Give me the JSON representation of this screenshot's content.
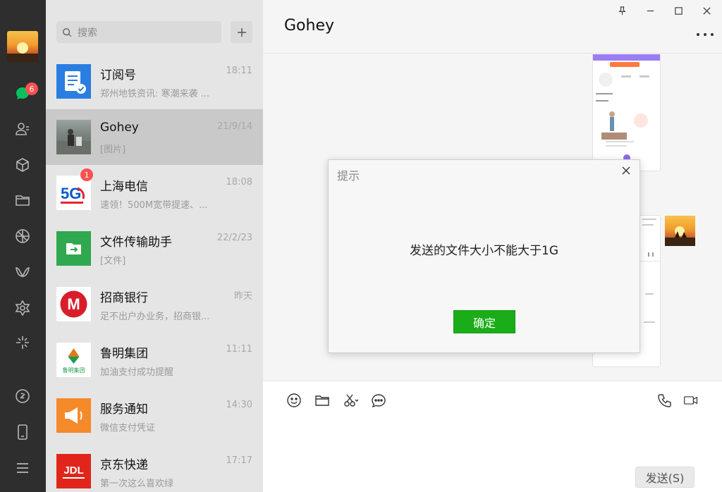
{
  "sidebar": {
    "unread_count": "6",
    "icons": [
      "chat-icon",
      "contacts-icon",
      "favorites-icon",
      "files-icon",
      "moments-icon",
      "channels-icon",
      "search-web-icon",
      "mini-programs-icon",
      "link-icon",
      "phone-icon",
      "menu-icon"
    ]
  },
  "search": {
    "placeholder": "搜索"
  },
  "chats": [
    {
      "name": "订阅号",
      "time": "18:11",
      "preview": "郑州地铁资讯: 寒潮来袭 ..."
    },
    {
      "name": "Gohey",
      "time": "21/9/14",
      "preview": "[图片]"
    },
    {
      "name": "上海电信",
      "time": "18:08",
      "preview": "速领！500M宽带提速、...",
      "badge": "1"
    },
    {
      "name": "文件传输助手",
      "time": "22/2/23",
      "preview": "[文件]"
    },
    {
      "name": "招商银行",
      "time": "昨天",
      "preview": "足不出户办业务，招商银...",
      "logo_text": "M"
    },
    {
      "name": "鲁明集团",
      "time": "11:11",
      "preview": "加油支付成功提醒",
      "logo_text": "鲁明集团"
    },
    {
      "name": "服务通知",
      "time": "14:30",
      "preview": "微信支付凭证"
    },
    {
      "name": "京东快递",
      "time": "17:17",
      "preview": "第一次这么喜欢绿",
      "logo_text": "JDL"
    }
  ],
  "chat": {
    "title": "Gohey",
    "send_label": "发送(S)"
  },
  "dialog": {
    "title": "提示",
    "message": "发送的文件大小不能大于1G",
    "ok_label": "确定"
  },
  "colors": {
    "rail_bg": "#2e2e2e",
    "list_bg": "#e6e5e5",
    "selected_bg": "#c9c9c9",
    "accent_green": "#1aad19",
    "badge_red": "#fa5151"
  }
}
